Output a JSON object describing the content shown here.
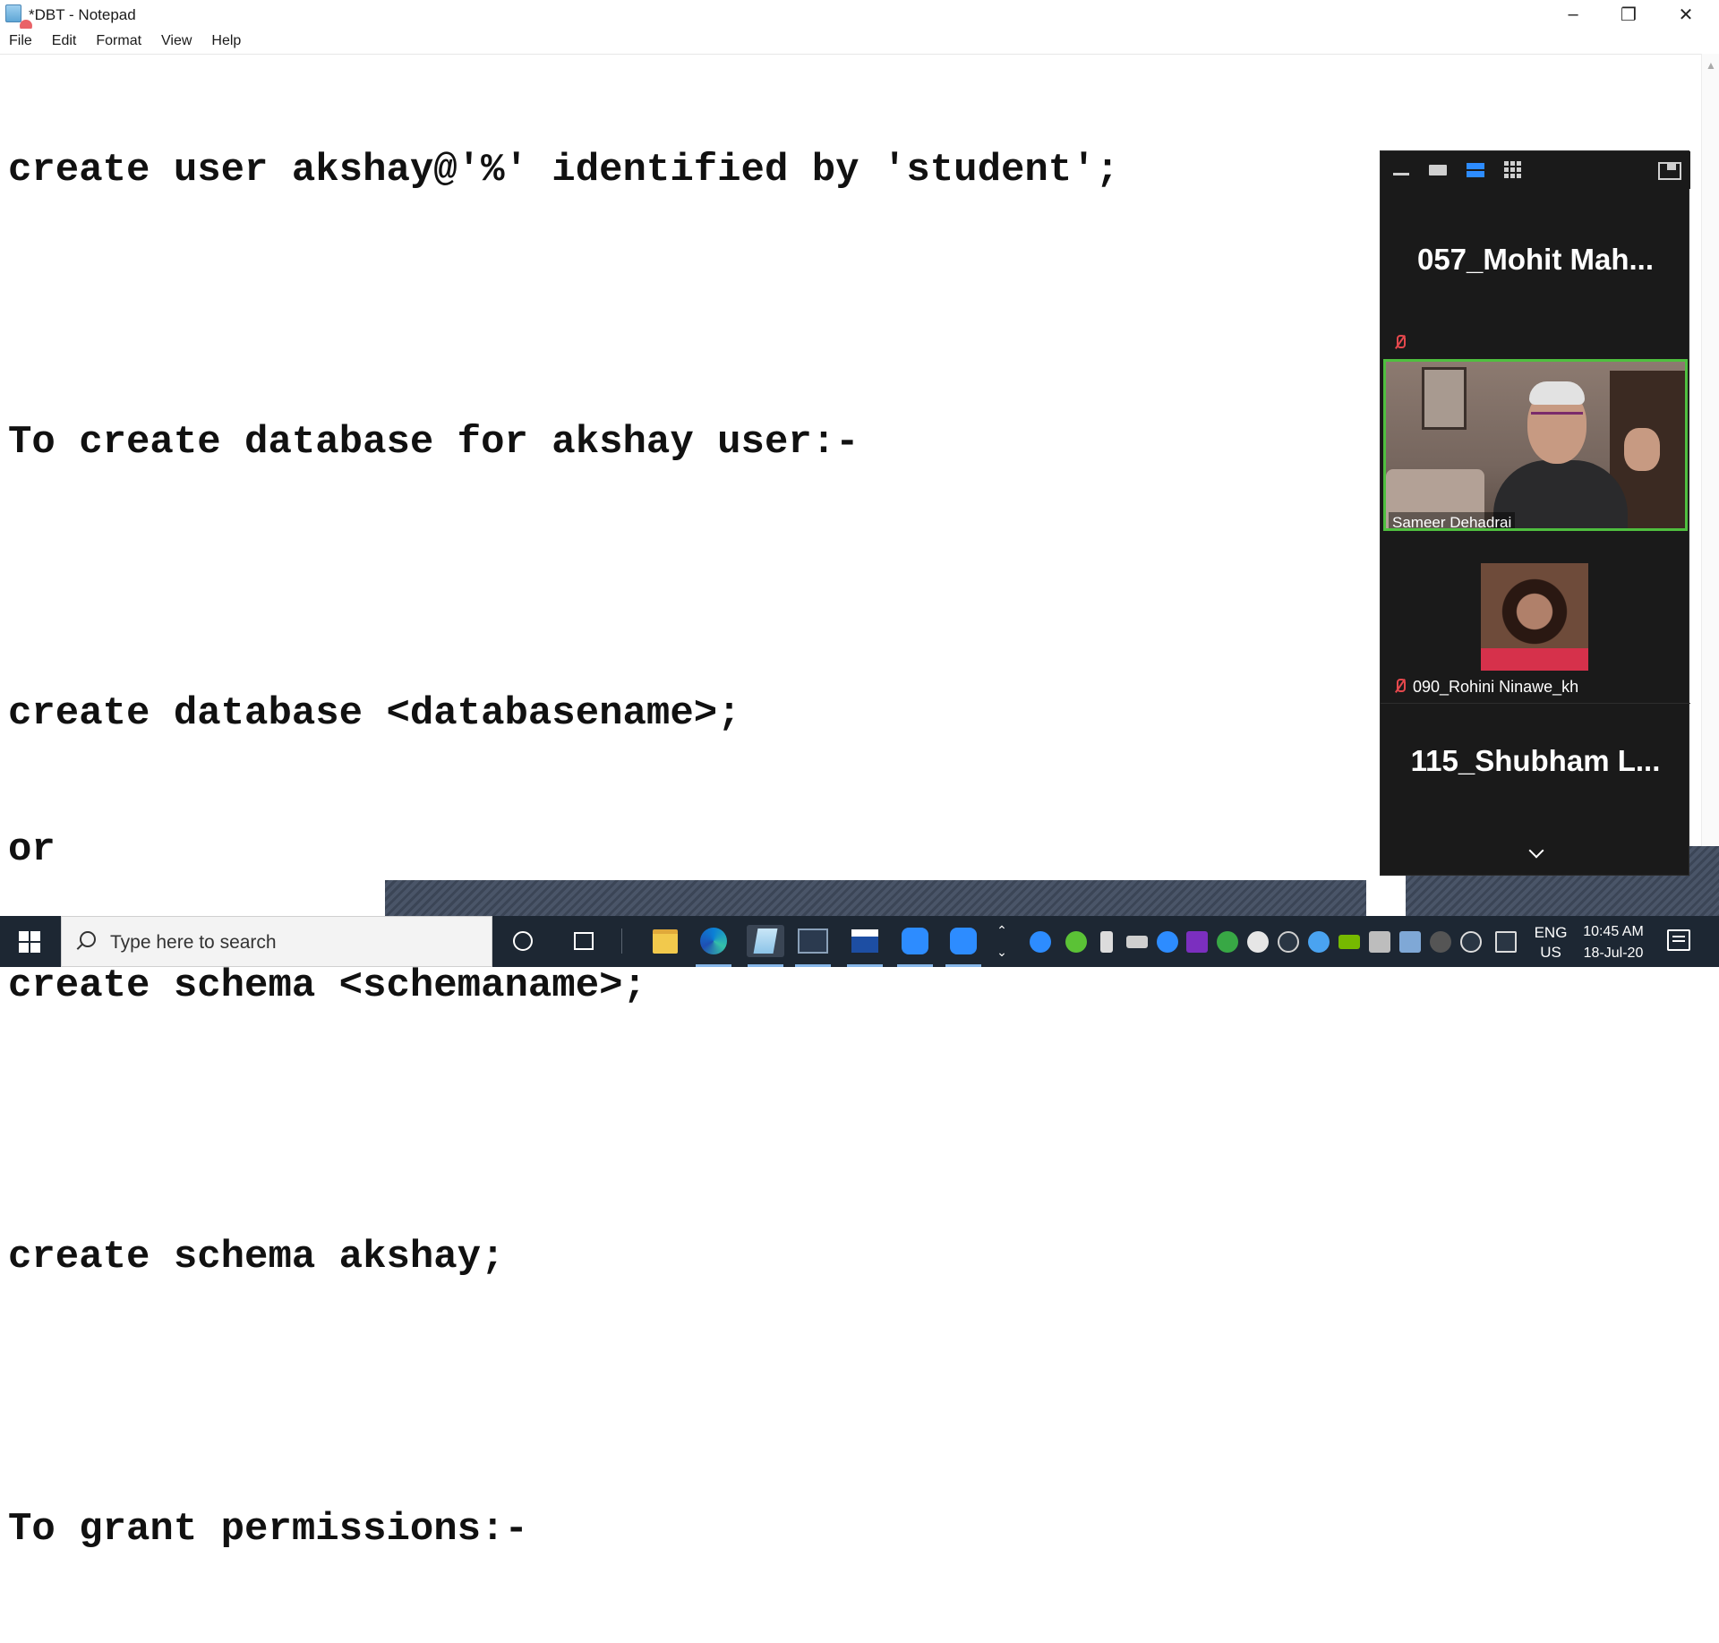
{
  "window": {
    "title": "*DBT - Notepad",
    "menu": [
      "File",
      "Edit",
      "Format",
      "View",
      "Help"
    ]
  },
  "editor": {
    "lines": [
      "create user akshay@'%' identified by 'student';",
      "",
      "To create database for akshay user:-",
      "",
      "create database <databasename>;",
      "or",
      "create schema <schemaname>;",
      "",
      "create schema akshay;",
      "",
      "To grant permissions:-"
    ]
  },
  "zoom": {
    "participants": [
      {
        "name": "057_Mohit  Mah...",
        "muted": true,
        "video": false
      },
      {
        "name": "Sameer Dehadrai",
        "muted": false,
        "video": true,
        "active_speaker": true
      },
      {
        "name": "090_Rohini Ninawe_kh",
        "muted": true,
        "video": false,
        "has_photo": true
      },
      {
        "name": "115_Shubham  L...",
        "muted": true,
        "video": false
      }
    ],
    "active_border_color": "#4fbf3f",
    "accent_color": "#2d8cff"
  },
  "taskbar": {
    "search_placeholder": "Type here to search",
    "language": "ENG",
    "region": "US",
    "time": "10:45 AM",
    "date": "18-Jul-20",
    "pinned_apps": [
      "file-explorer",
      "edge",
      "notepad",
      "mysql",
      "workbench",
      "zoom",
      "zoom-meeting"
    ]
  }
}
